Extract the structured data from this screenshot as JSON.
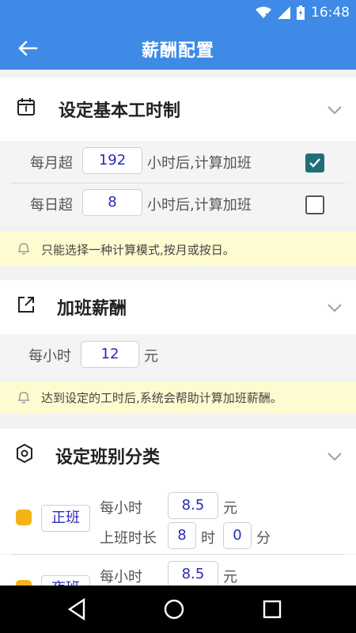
{
  "status_bar": {
    "time": "16:48"
  },
  "app_bar": {
    "title": "薪酬配置"
  },
  "work_system": {
    "title": "设定基本工时制",
    "monthly": {
      "prefix": "每月超",
      "value": "192",
      "suffix": "小时后,计算加班",
      "checked": true
    },
    "daily": {
      "prefix": "每日超",
      "value": "8",
      "suffix": "小时后,计算加班",
      "checked": false
    },
    "notice": "只能选择一种计算模式,按月或按日。"
  },
  "overtime_pay": {
    "title": "加班薪酬",
    "per_hour_label": "每小时",
    "per_hour_value": "12",
    "unit": "元",
    "notice": "达到设定的工时后,系统会帮助计算加班薪酬。"
  },
  "shift_types": {
    "title": "设定班别分类",
    "items": [
      {
        "name": "正班",
        "per_hour_label": "每小时",
        "per_hour_value": "8.5",
        "unit": "元",
        "duration_label": "上班时长",
        "hours": "8",
        "hours_unit": "时",
        "minutes": "0",
        "minutes_unit": "分"
      },
      {
        "name": "夜班",
        "per_hour_label": "每小时",
        "per_hour_value": "8.5",
        "unit": "元"
      }
    ]
  }
}
